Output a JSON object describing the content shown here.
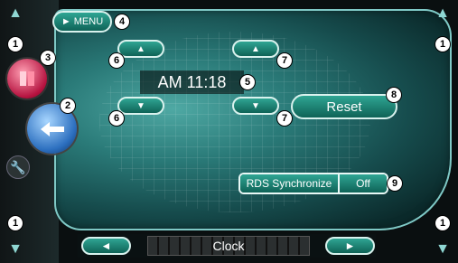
{
  "menu": {
    "label": "MENU",
    "play_glyph": "►"
  },
  "clock": {
    "time_text": "AM 11:18"
  },
  "buttons": {
    "hour_up": "▲",
    "hour_down": "▼",
    "minute_up": "▲",
    "minute_down": "▼",
    "reset": "Reset"
  },
  "rds": {
    "label": "RDS Synchronize",
    "value": "Off"
  },
  "bottom": {
    "title": "Clock",
    "prev": "◄",
    "next": "►"
  },
  "callouts": {
    "c1": "1",
    "c2": "2",
    "c3": "3",
    "c4": "4",
    "c5": "5",
    "c6": "6",
    "c7": "7",
    "c8": "8",
    "c9": "9"
  },
  "icons": {
    "corner_up": "▲",
    "corner_down": "▼",
    "wrench": "🔧"
  },
  "colors": {
    "panel_accent": "#2fa593",
    "source_button": "#b5123f",
    "back_button": "#2c6fbf"
  }
}
